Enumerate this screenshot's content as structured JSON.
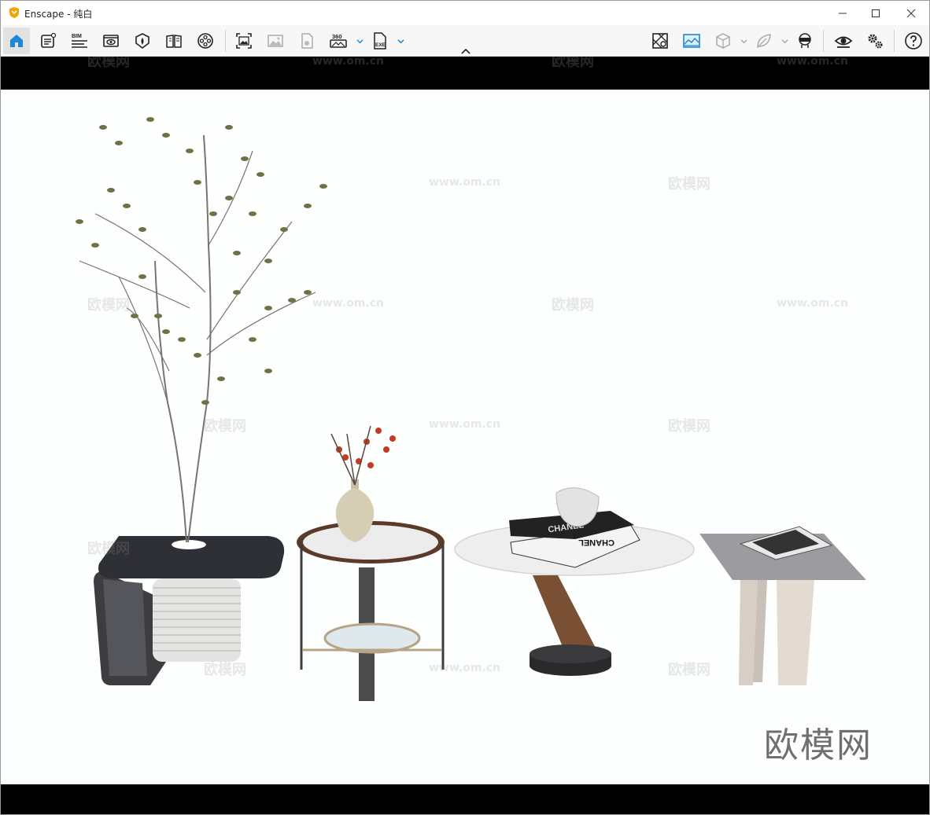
{
  "window": {
    "title": "Enscape - 纯白",
    "accent_color": "#f5a100"
  },
  "toolbar": {
    "left_buttons": [
      {
        "name": "home-icon",
        "active": true
      },
      {
        "name": "asset-library-icon"
      },
      {
        "name": "bim-icon"
      },
      {
        "name": "views-icon"
      },
      {
        "name": "atmosphere-icon"
      },
      {
        "name": "material-editor-icon"
      },
      {
        "name": "video-editor-icon"
      },
      {
        "name": "capture-screenshot-icon"
      },
      {
        "name": "gallery-icon"
      },
      {
        "name": "export-panorama-icon"
      },
      {
        "name": "360-panorama-icon"
      },
      {
        "name": "exe-export-icon"
      }
    ],
    "right_buttons": [
      {
        "name": "map-icon"
      },
      {
        "name": "render-mode-icon"
      },
      {
        "name": "cube-icon"
      },
      {
        "name": "leaf-icon"
      },
      {
        "name": "vr-headset-icon"
      },
      {
        "name": "visual-settings-icon"
      },
      {
        "name": "general-settings-icon"
      },
      {
        "name": "help-icon"
      }
    ],
    "bim_label": "BIM",
    "pano_label": "360",
    "exe_label": "EXE"
  },
  "viewport": {
    "watermark_text": "欧模网",
    "watermark_url": "www.om.cn",
    "logo_text": "欧模网",
    "book_label_1": "CHANEL",
    "book_label_2": "CHANEL"
  }
}
